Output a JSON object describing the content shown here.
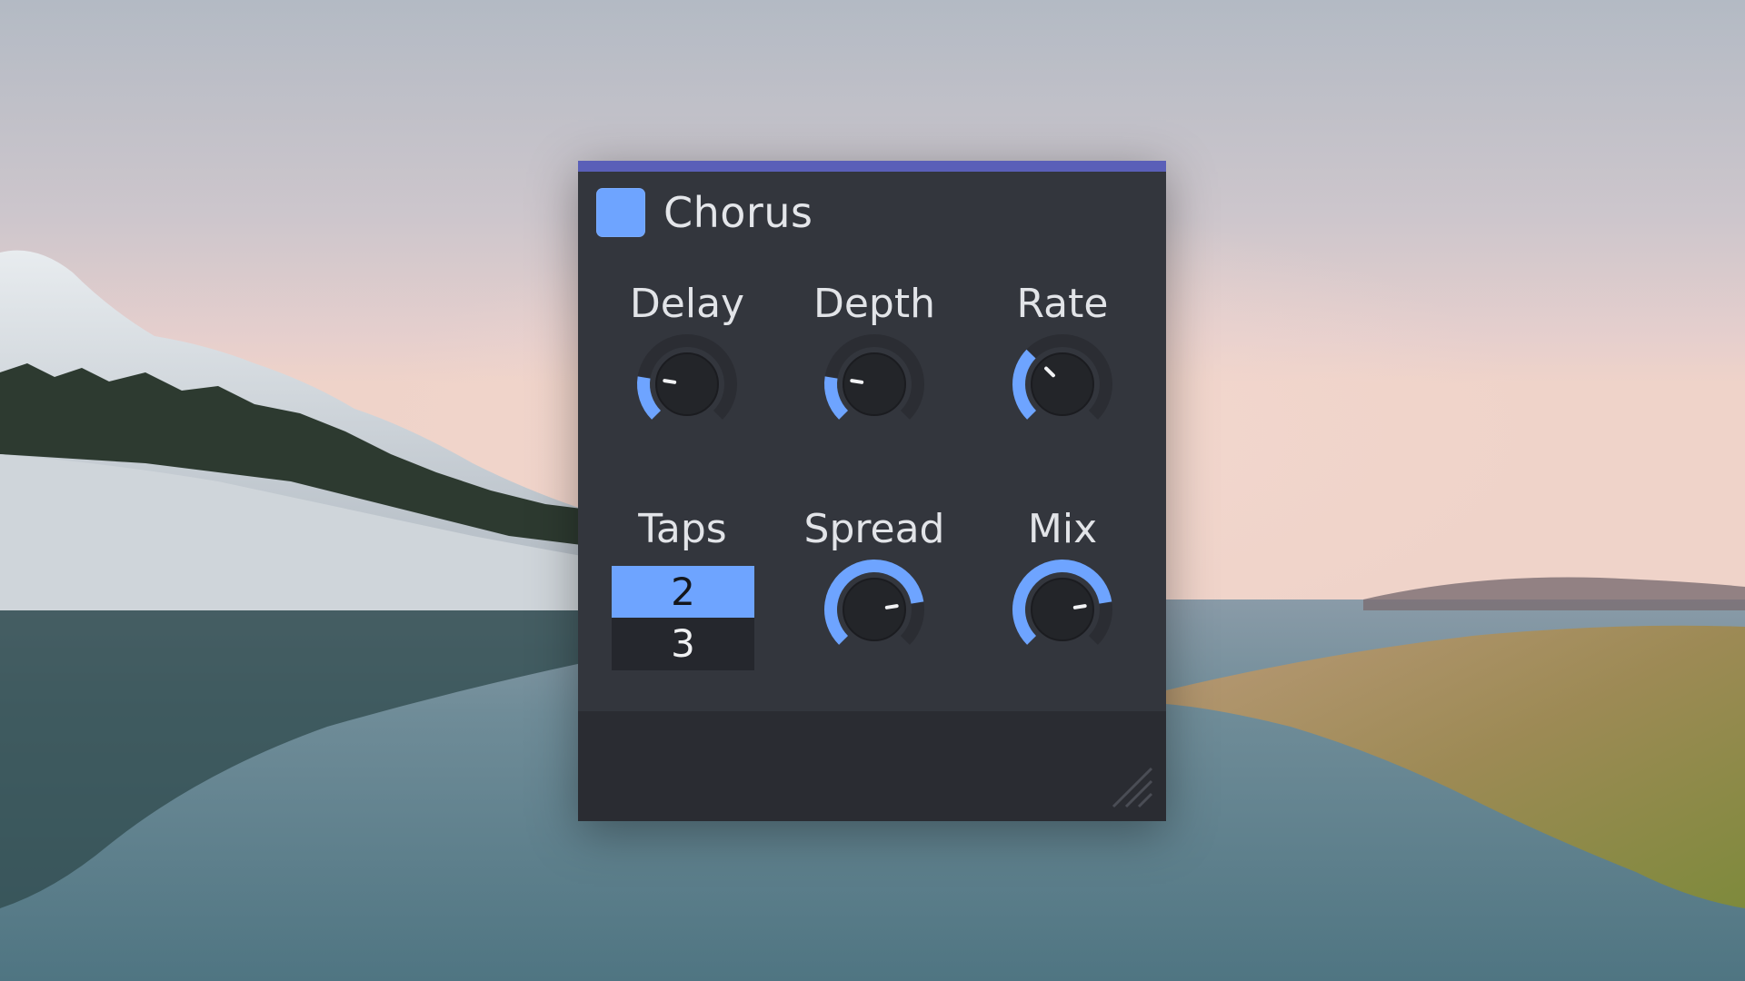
{
  "plugin": {
    "title": "Chorus",
    "enabled": true,
    "accent_color": "#6ea4ff",
    "header_bar_color": "#5a5fb8",
    "panel_color": "#33363d"
  },
  "params": {
    "delay": {
      "label": "Delay",
      "level": 0.2
    },
    "depth": {
      "label": "Depth",
      "level": 0.2
    },
    "rate": {
      "label": "Rate",
      "level": 0.33
    },
    "taps": {
      "label": "Taps",
      "options": [
        "2",
        "3"
      ],
      "selected": "2"
    },
    "spread": {
      "label": "Spread",
      "level": 0.8
    },
    "mix": {
      "label": "Mix",
      "level": 0.8
    }
  },
  "icons": {
    "enable_toggle": "square-toggle-icon",
    "resize": "resize-grip-icon"
  }
}
